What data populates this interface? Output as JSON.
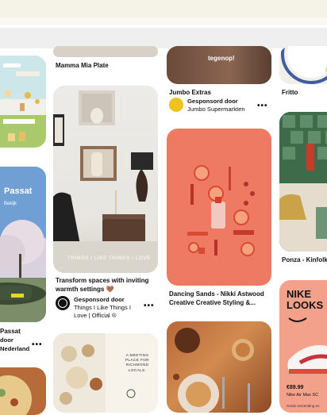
{
  "pins": {
    "col1_top": {
      "title": "Passat",
      "sponsor_label": "door",
      "sponsor_name": "Nederland"
    },
    "col1_img": {
      "overlay_text": "Passat",
      "overlay_sub": "Bekijk"
    },
    "col2_top": {
      "title": "Mamma Mia Plate"
    },
    "col2_mid": {
      "overlay": "THINGS I LIKE THINGS I LOVE",
      "title": "Transform spaces with inviting warmth settings 🤎",
      "sponsor_label": "Gesponsord door",
      "sponsor_name": "Things I Like Things I Love | Official ®",
      "more": "•••"
    },
    "col2_bottom": {
      "card_text": "A MEETING PLACE FOR RICHMOND LOCALS."
    },
    "col3_top": {
      "overlay": "tegenop!",
      "title": "Jumbo Extras",
      "sponsor_label": "Gesponsord door",
      "sponsor_name": "Jumbo Supermarkten",
      "more": "•••"
    },
    "col3_mid": {
      "title": "Dancing Sands - Nikki Astwood Creative Creative Styling &..."
    },
    "col4_top": {
      "title": "Fritto"
    },
    "col4_mid": {
      "title": "Ponza - Kinfolk"
    },
    "col4_bottom": {
      "brand_line1": "NIKE",
      "brand_line2": "LOOKS",
      "price": "€89.99",
      "product": "Nike Air Max SC",
      "small": "Gratis verzending en"
    },
    "col1_more": "•••"
  },
  "colors": {
    "coral": "#ef7a63",
    "tile_green": "#3e6c4b",
    "nike_pink": "#f4a18c",
    "jumbo_yellow": "#f0c21d"
  }
}
